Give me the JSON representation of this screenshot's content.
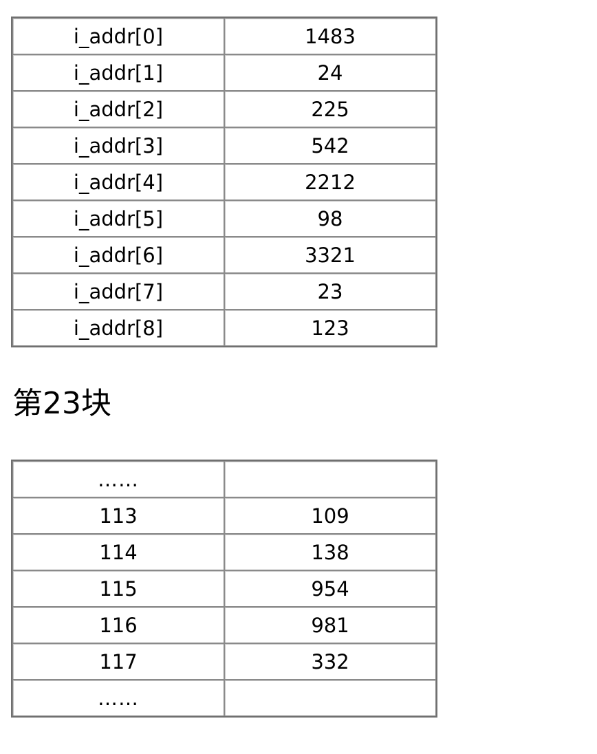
{
  "table1": {
    "rows": [
      [
        "i_addr[0]",
        "1483"
      ],
      [
        "i_addr[1]",
        "24"
      ],
      [
        "i_addr[2]",
        "225"
      ],
      [
        "i_addr[3]",
        "542"
      ],
      [
        "i_addr[4]",
        "2212"
      ],
      [
        "i_addr[5]",
        "98"
      ],
      [
        "i_addr[6]",
        "3321"
      ],
      [
        "i_addr[7]",
        "23"
      ],
      [
        "i_addr[8]",
        "123"
      ]
    ]
  },
  "heading": "第23块",
  "table2": {
    "rows": [
      [
        "……",
        ""
      ],
      [
        "113",
        "109"
      ],
      [
        "114",
        "138"
      ],
      [
        "115",
        "954"
      ],
      [
        "116",
        "981"
      ],
      [
        "117",
        "332"
      ],
      [
        "……",
        ""
      ]
    ]
  }
}
